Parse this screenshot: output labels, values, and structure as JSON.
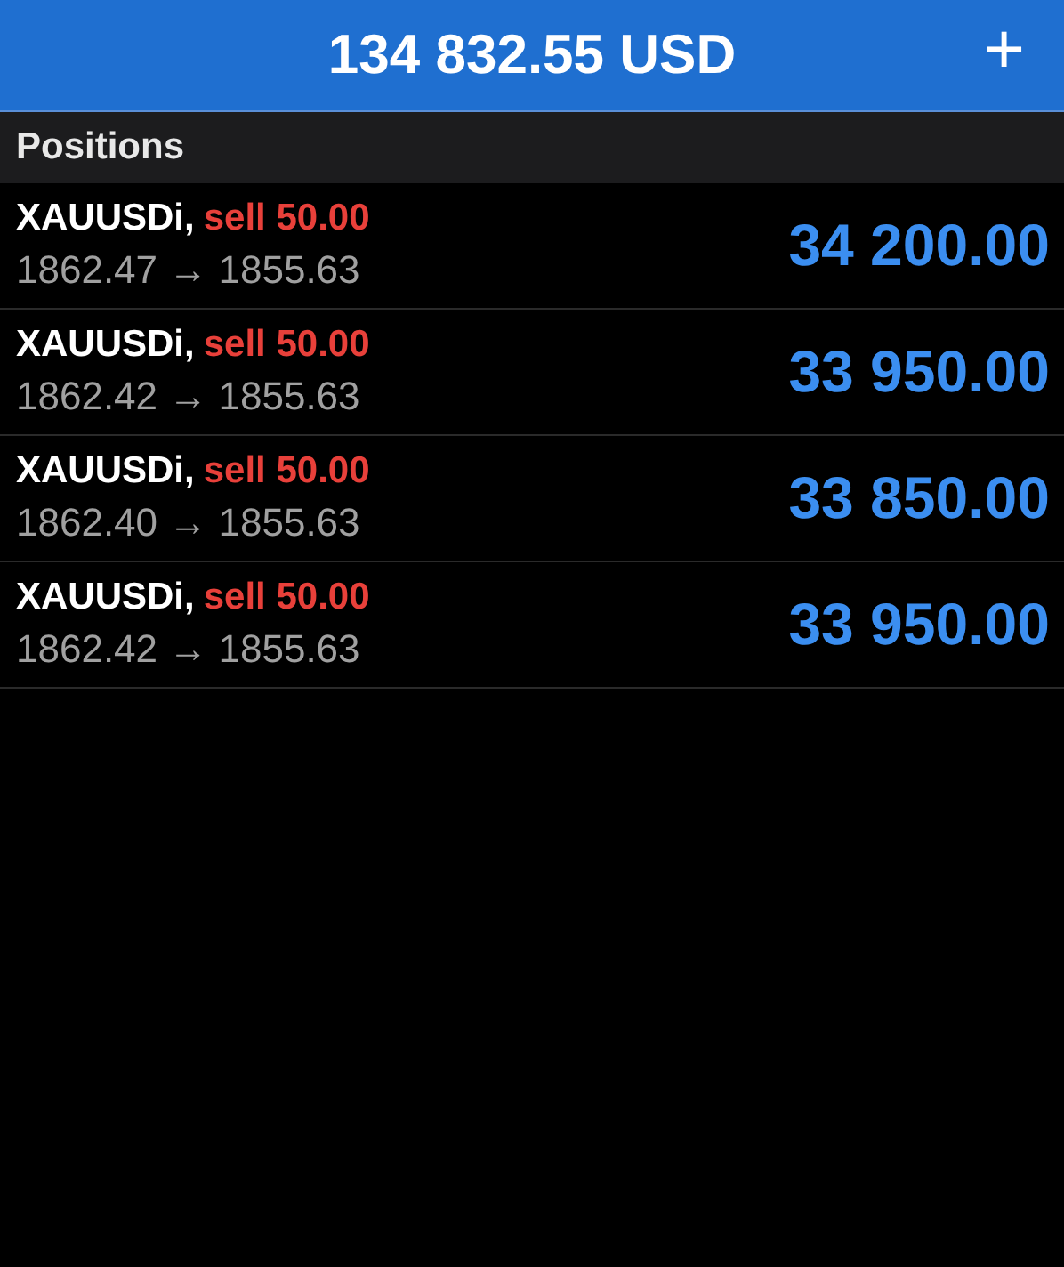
{
  "header": {
    "balance": "134 832.55 USD",
    "add_icon": "+"
  },
  "section": {
    "title": "Positions"
  },
  "positions": [
    {
      "symbol": "XAUUSDi,",
      "order": "sell 50.00",
      "color": "#e8403a",
      "prices": "1862.47 → 1855.63",
      "profit": "34 200.00"
    },
    {
      "symbol": "XAUUSDi,",
      "order": "sell 50.00",
      "color": "#e8403a",
      "prices": "1862.42 → 1855.63",
      "profit": "33 950.00"
    },
    {
      "symbol": "XAUUSDi,",
      "order": "sell 50.00",
      "color": "#e8403a",
      "prices": "1862.40 → 1855.63",
      "profit": "33 850.00"
    },
    {
      "symbol": "XAUUSDi,",
      "order": "sell 50.00",
      "color": "#e8403a",
      "prices": "1862.42 → 1855.63",
      "profit": "33 950.00"
    }
  ]
}
